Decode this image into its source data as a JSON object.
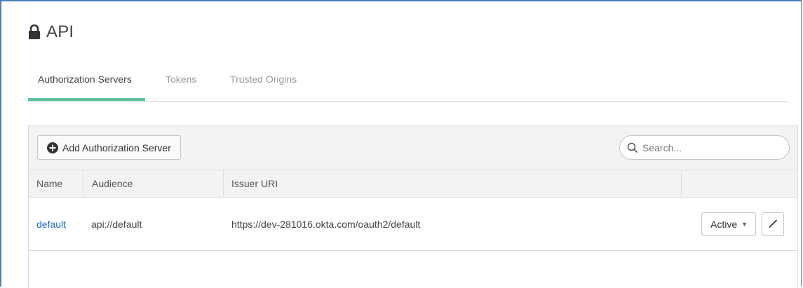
{
  "header": {
    "title": "API",
    "icon": "lock-icon"
  },
  "tabs": [
    {
      "label": "Authorization Servers",
      "active": true
    },
    {
      "label": "Tokens",
      "active": false
    },
    {
      "label": "Trusted Origins",
      "active": false
    }
  ],
  "toolbar": {
    "add_button_label": "Add Authorization Server",
    "add_icon": "plus-circle-icon",
    "search_placeholder": "Search...",
    "search_value": ""
  },
  "table": {
    "columns": [
      "Name",
      "Audience",
      "Issuer URI",
      ""
    ],
    "rows": [
      {
        "name": "default",
        "audience": "api://default",
        "issuer_uri": "https://dev-281016.okta.com/oauth2/default",
        "status": "Active",
        "edit_icon": "pencil-icon"
      }
    ]
  },
  "colors": {
    "active_tab_underline": "#5ac4a0",
    "link": "#1d6bb0",
    "frame_border": "#4a7ebb"
  }
}
